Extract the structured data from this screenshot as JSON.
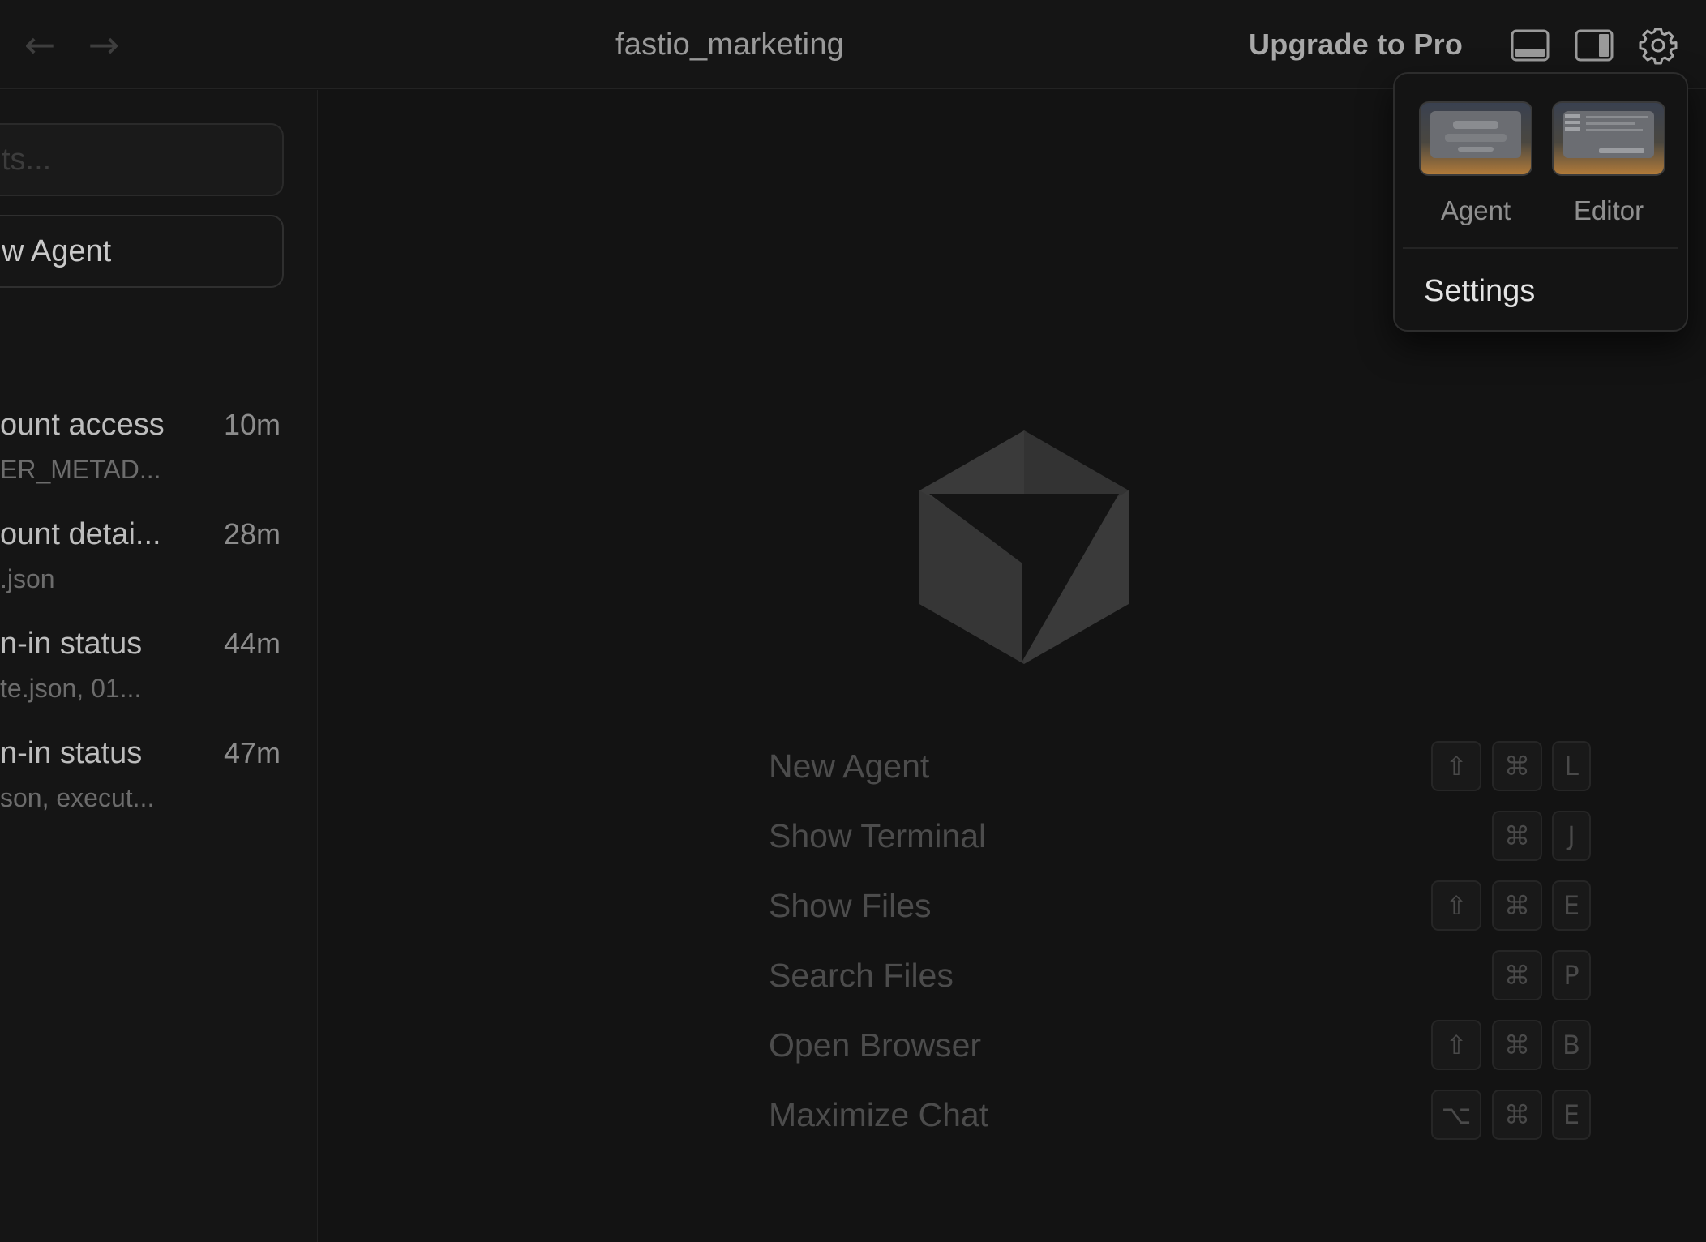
{
  "topbar": {
    "back_icon": "arrow-left-icon",
    "forward_icon": "arrow-right-icon",
    "title": "fastio_marketing",
    "upgrade_label": "Upgrade to Pro",
    "panel_bottom_icon": "panel-bottom-icon",
    "panel_right_icon": "panel-right-icon",
    "settings_icon": "gear-icon"
  },
  "sidebar": {
    "search_placeholder": "ts...",
    "new_agent_label": "w Agent",
    "agents": [
      {
        "title": "ount access",
        "subtitle": "ER_METAD...",
        "time": "10m"
      },
      {
        "title": "ount detai...",
        "subtitle": ".json",
        "time": "28m"
      },
      {
        "title": "n-in status",
        "subtitle": "te.json, 01...",
        "time": "44m"
      },
      {
        "title": "n-in status",
        "subtitle": "son, execut...",
        "time": "47m"
      }
    ]
  },
  "main": {
    "logo_icon": "cursor-cube-logo-icon",
    "shortcuts": [
      {
        "label": "New Agent",
        "keys": [
          "⇧",
          "⌘",
          "L"
        ]
      },
      {
        "label": "Show Terminal",
        "keys": [
          "⌘",
          "J"
        ]
      },
      {
        "label": "Show Files",
        "keys": [
          "⇧",
          "⌘",
          "E"
        ]
      },
      {
        "label": "Search Files",
        "keys": [
          "⌘",
          "P"
        ]
      },
      {
        "label": "Open Browser",
        "keys": [
          "⇧",
          "⌘",
          "B"
        ]
      },
      {
        "label": "Maximize Chat",
        "keys": [
          "⌥",
          "⌘",
          "E"
        ]
      }
    ]
  },
  "popover": {
    "layouts": [
      {
        "label": "Agent"
      },
      {
        "label": "Editor"
      }
    ],
    "settings_label": "Settings"
  }
}
